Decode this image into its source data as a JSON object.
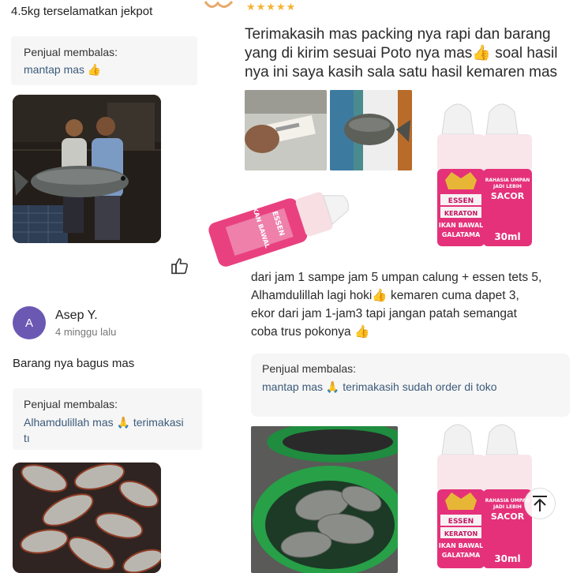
{
  "left": {
    "review1_text_tail": "4.5kg terselamatkan jekpot",
    "seller_reply_1": {
      "label": "Penjual membalas:",
      "text": "mantap mas 👍"
    },
    "like_icon": "thumbs-up-icon",
    "reviewer2": {
      "initial": "A",
      "name": "Asep Y.",
      "date": "4 minggu lalu"
    },
    "review2_text": "Barang nya bagus mas",
    "seller_reply_2": {
      "label": "Penjual membalas:",
      "line1": "Alhamdulillah mas 🙏 terimakasi",
      "line2": "tı"
    }
  },
  "right": {
    "stars": "★★★★★",
    "review_lines": [
      "Terimakasih mas packing nya rapi dan barang",
      "yang di kirim sesuai Poto nya mas👍 soal hasil",
      "nya ini saya kasih sala satu hasil kemaren mas"
    ],
    "product": {
      "brand_top": "ESSEN",
      "brand_main": "KERATON",
      "name1": "IKAN BAWAL",
      "name2": "GALATAMA",
      "tag1": "RAHASIA UMPAN",
      "tag2": "JADI LEBIH",
      "tag3": "SACOR",
      "volume": "30ml"
    },
    "review_lines2": [
      "dari jam 1 sampe jam 5 umpan calung + essen tets 5,",
      "Alhamdulillah lagi hoki👍 kemaren cuma dapet 3,",
      "ekor dari jam 1-jam3 tapi jangan patah semangat",
      "coba trus pokonya 👍"
    ],
    "seller_reply_3": {
      "label": "Penjual membalas:",
      "text": "mantap mas 🙏 terimakasih sudah order di toko"
    },
    "scroll_top_icon": "arrow-up-icon"
  }
}
